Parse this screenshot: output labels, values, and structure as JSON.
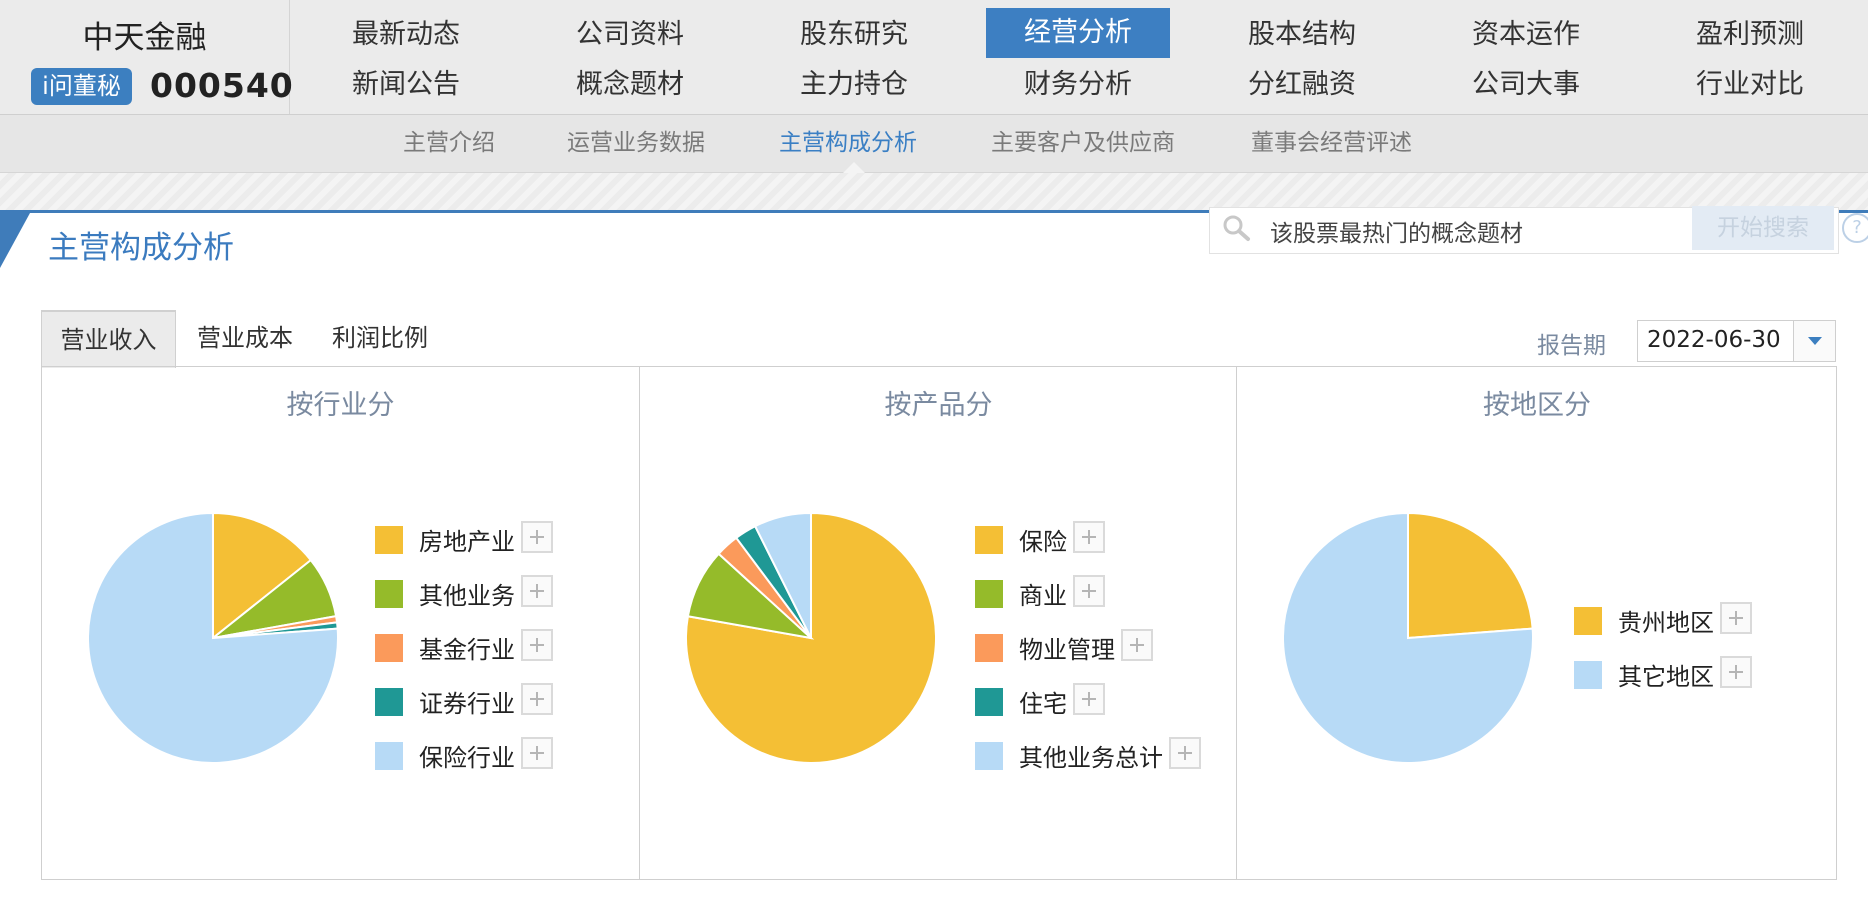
{
  "company": {
    "name": "中天金融",
    "badge": "i问董秘",
    "code": "000540"
  },
  "nav": {
    "row1": [
      "最新动态",
      "公司资料",
      "股东研究",
      "经营分析",
      "股本结构",
      "资本运作",
      "盈利预测"
    ],
    "row2": [
      "新闻公告",
      "概念题材",
      "主力持仓",
      "财务分析",
      "分红融资",
      "公司大事",
      "行业对比"
    ],
    "active": "经营分析"
  },
  "subnav": {
    "items": [
      "主营介绍",
      "运营业务数据",
      "主营构成分析",
      "主要客户及供应商",
      "董事会经营评述"
    ],
    "active": "主营构成分析"
  },
  "section": {
    "title": "主营构成分析"
  },
  "search": {
    "placeholder": "该股票最热门的概念题材",
    "button": "开始搜索",
    "help": "?"
  },
  "tabs": {
    "items": [
      "营业收入",
      "营业成本",
      "利润比例"
    ],
    "active": "营业收入"
  },
  "period": {
    "label": "报告期",
    "value": "2022-06-30"
  },
  "colors": {
    "yellow": "#f4bf35",
    "green": "#95bb2a",
    "orange": "#fb9a5b",
    "teal": "#1f9895",
    "lightblue": "#b7daf6",
    "accent": "#3d7fc2"
  },
  "chart_data": [
    {
      "type": "pie",
      "title": "按行业分",
      "categories": [
        "房地产业",
        "其他业务",
        "基金行业",
        "证券行业",
        "保险行业"
      ],
      "values": [
        14.3,
        7.9,
        0.8,
        0.8,
        76.2
      ],
      "colors": [
        "#f4bf35",
        "#95bb2a",
        "#fb9a5b",
        "#1f9895",
        "#b7daf6"
      ]
    },
    {
      "type": "pie",
      "title": "按产品分",
      "categories": [
        "保险",
        "商业",
        "物业管理",
        "住宅",
        "其他业务总计"
      ],
      "values": [
        77.0,
        8.9,
        3.0,
        2.8,
        7.3
      ],
      "colors": [
        "#f4bf35",
        "#95bb2a",
        "#fb9a5b",
        "#1f9895",
        "#b7daf6"
      ]
    },
    {
      "type": "pie",
      "title": "按地区分",
      "categories": [
        "贵州地区",
        "其它地区"
      ],
      "values": [
        23.8,
        76.2
      ],
      "colors": [
        "#f4bf35",
        "#b7daf6"
      ]
    }
  ]
}
